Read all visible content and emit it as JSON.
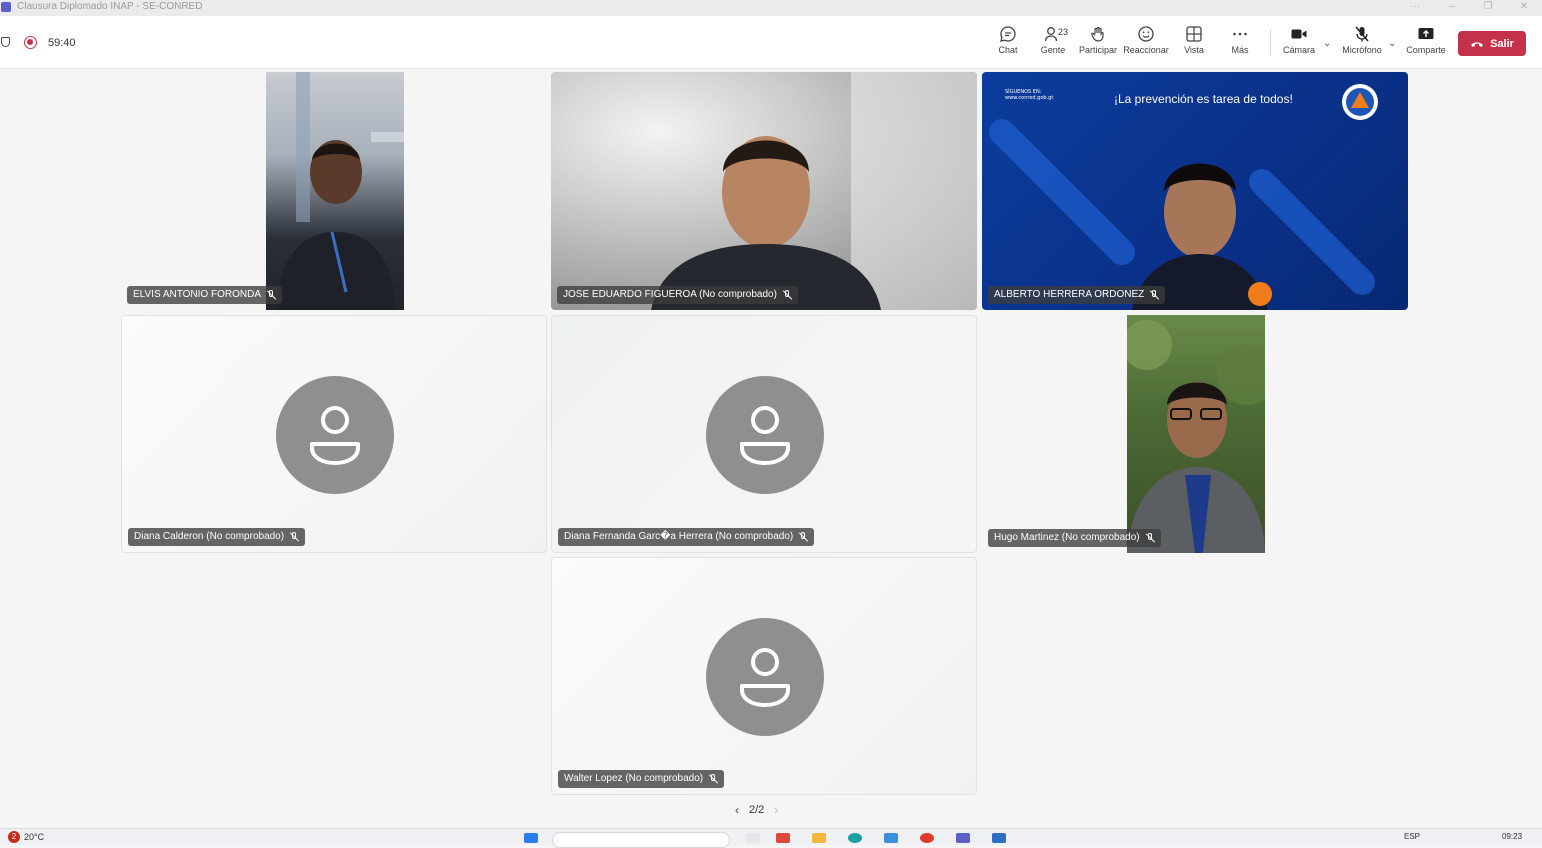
{
  "window": {
    "title": "Clausura Diplomado INAP - SE-CONRED",
    "controls": {
      "more": "···",
      "minimize": "–",
      "restore": "❐",
      "close": "✕"
    }
  },
  "meeting": {
    "elapsed": "59:40",
    "recording": true
  },
  "toolbar": {
    "chat": "Chat",
    "people": "Gente",
    "people_count": "23",
    "raise_hand": "Participar",
    "react": "Reaccionar",
    "view": "Vista",
    "more": "Más",
    "camera": "Cámara",
    "mic": "Micrófono",
    "share": "Comparte",
    "leave": "Salir"
  },
  "participants": [
    {
      "name": "ELVIS ANTONIO FORONDA",
      "video": true,
      "muted": true
    },
    {
      "name": "JOSE EDUARDO FIGUEROA (No comprobado)",
      "video": true,
      "muted": true
    },
    {
      "name": "ALBERTO HERRERA ORDONEZ",
      "video": true,
      "muted": true
    },
    {
      "name": "Diana Calderon (No comprobado)",
      "video": false,
      "muted": true
    },
    {
      "name": "Diana Fernanda Garc�a Herrera (No comprobado)",
      "video": false,
      "muted": true
    },
    {
      "name": "Hugo Martinez (No comprobado)",
      "video": true,
      "muted": true
    },
    {
      "name": "Walter Lopez (No comprobado)",
      "video": false,
      "muted": true
    }
  ],
  "background_banner": {
    "text": "¡La prevención es tarea de todos!",
    "social": "SÍGUENOS EN: www.conred.gob.gt"
  },
  "pagination": {
    "label": "2/2"
  },
  "taskbar": {
    "notifications": "2",
    "weather": "20°C",
    "language": "ESP",
    "time": "09:23"
  },
  "colors": {
    "leave": "#c4314b",
    "accent": "#5b5fc7",
    "banner_blue": "#0b3d9c"
  }
}
